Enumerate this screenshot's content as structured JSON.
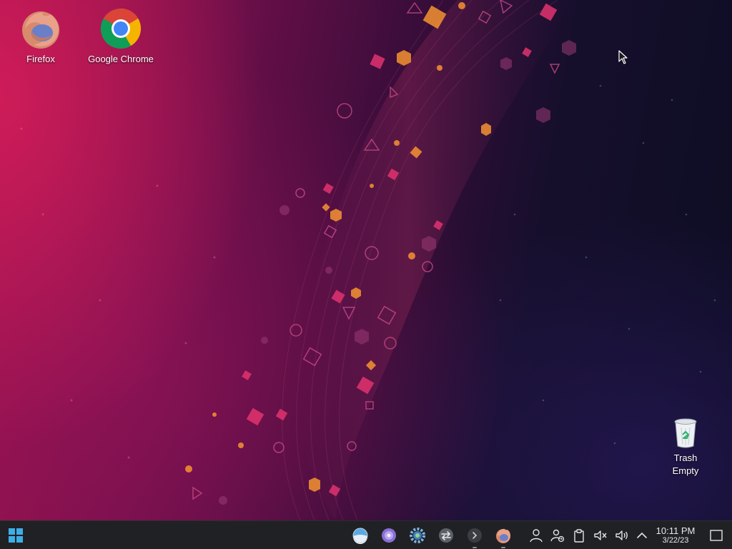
{
  "desktop": {
    "icons": [
      {
        "label": "Firefox",
        "icon": "firefox-icon"
      },
      {
        "label": "Google Chrome",
        "icon": "chrome-icon"
      }
    ],
    "trash": {
      "label": "Trash",
      "status": "Empty",
      "icon": "trash-icon"
    }
  },
  "taskbar": {
    "start_icon": "start-menu-icon",
    "apps": [
      {
        "icon": "system-settings-icon",
        "running": false
      },
      {
        "icon": "discover-icon",
        "running": false
      },
      {
        "icon": "settings-gear-icon",
        "running": false
      },
      {
        "icon": "switch-icon",
        "running": false
      },
      {
        "icon": "terminal-icon",
        "running": true
      },
      {
        "icon": "firefox-icon",
        "running": true
      }
    ],
    "tray": [
      "user-icon",
      "user-switch-icon",
      "clipboard-icon",
      "speaker-muted-icon",
      "volume-icon",
      "tray-expand-icon"
    ],
    "clock": {
      "time": "10:11 PM",
      "date": "3/22/23"
    },
    "show_desktop_icon": "show-desktop-icon"
  },
  "colors": {
    "taskbar_bg": "#202124",
    "accent_blue": "#3daee9",
    "wallpaper_magenta": "#c2185b",
    "wallpaper_orange": "#f59331",
    "wallpaper_navy": "#0c0d22"
  }
}
